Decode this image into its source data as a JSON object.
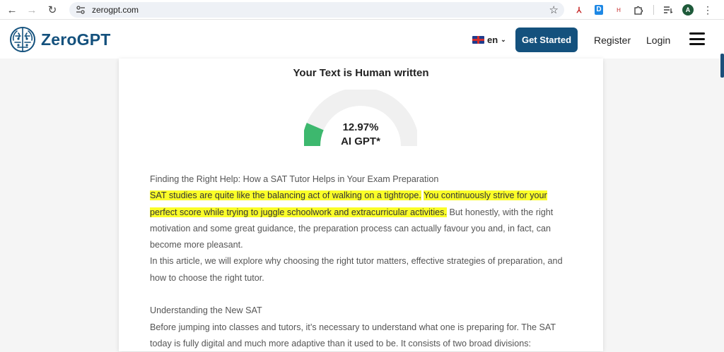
{
  "browser": {
    "url": "zerogpt.com",
    "avatar_letter": "A",
    "ext_icons": [
      "adobe-icon",
      "pdf-icon",
      "hl-icon",
      "puzzle-icon",
      "reading-list-icon"
    ]
  },
  "header": {
    "logo_text": "ZeroGPT",
    "lang": "en",
    "get_started": "Get Started",
    "register": "Register",
    "login": "Login"
  },
  "result": {
    "title": "Your Text is Human written",
    "percent": "12.97%",
    "percent_value": 12.97,
    "label": "AI GPT*",
    "gauge_color": "#3db86e"
  },
  "article": {
    "title": "Finding the Right Help: How a SAT Tutor Helps in Your Exam Preparation",
    "hl1": "SAT studies are quite like the balancing act of walking on a tightrope.",
    "hl2": "You continuously strive for your perfect score while trying to juggle schoolwork and extracurricular activities.",
    "p1_rest": " But honestly, with the right motivation and some great guidance, the preparation process can actually favour you and, in fact, can become more pleasant.",
    "p2": "In this article, we will explore why choosing the right tutor matters, effective strategies of preparation, and how to choose the right tutor.",
    "h2": "Understanding the New SAT",
    "p3": "Before jumping into classes and tutors, it’s necessary to understand what one is preparing for. The SAT today is fully digital and much more adaptive than it used to be. It consists of two broad divisions:"
  },
  "colors": {
    "brand": "#14517d",
    "highlight": "#fafd28"
  }
}
